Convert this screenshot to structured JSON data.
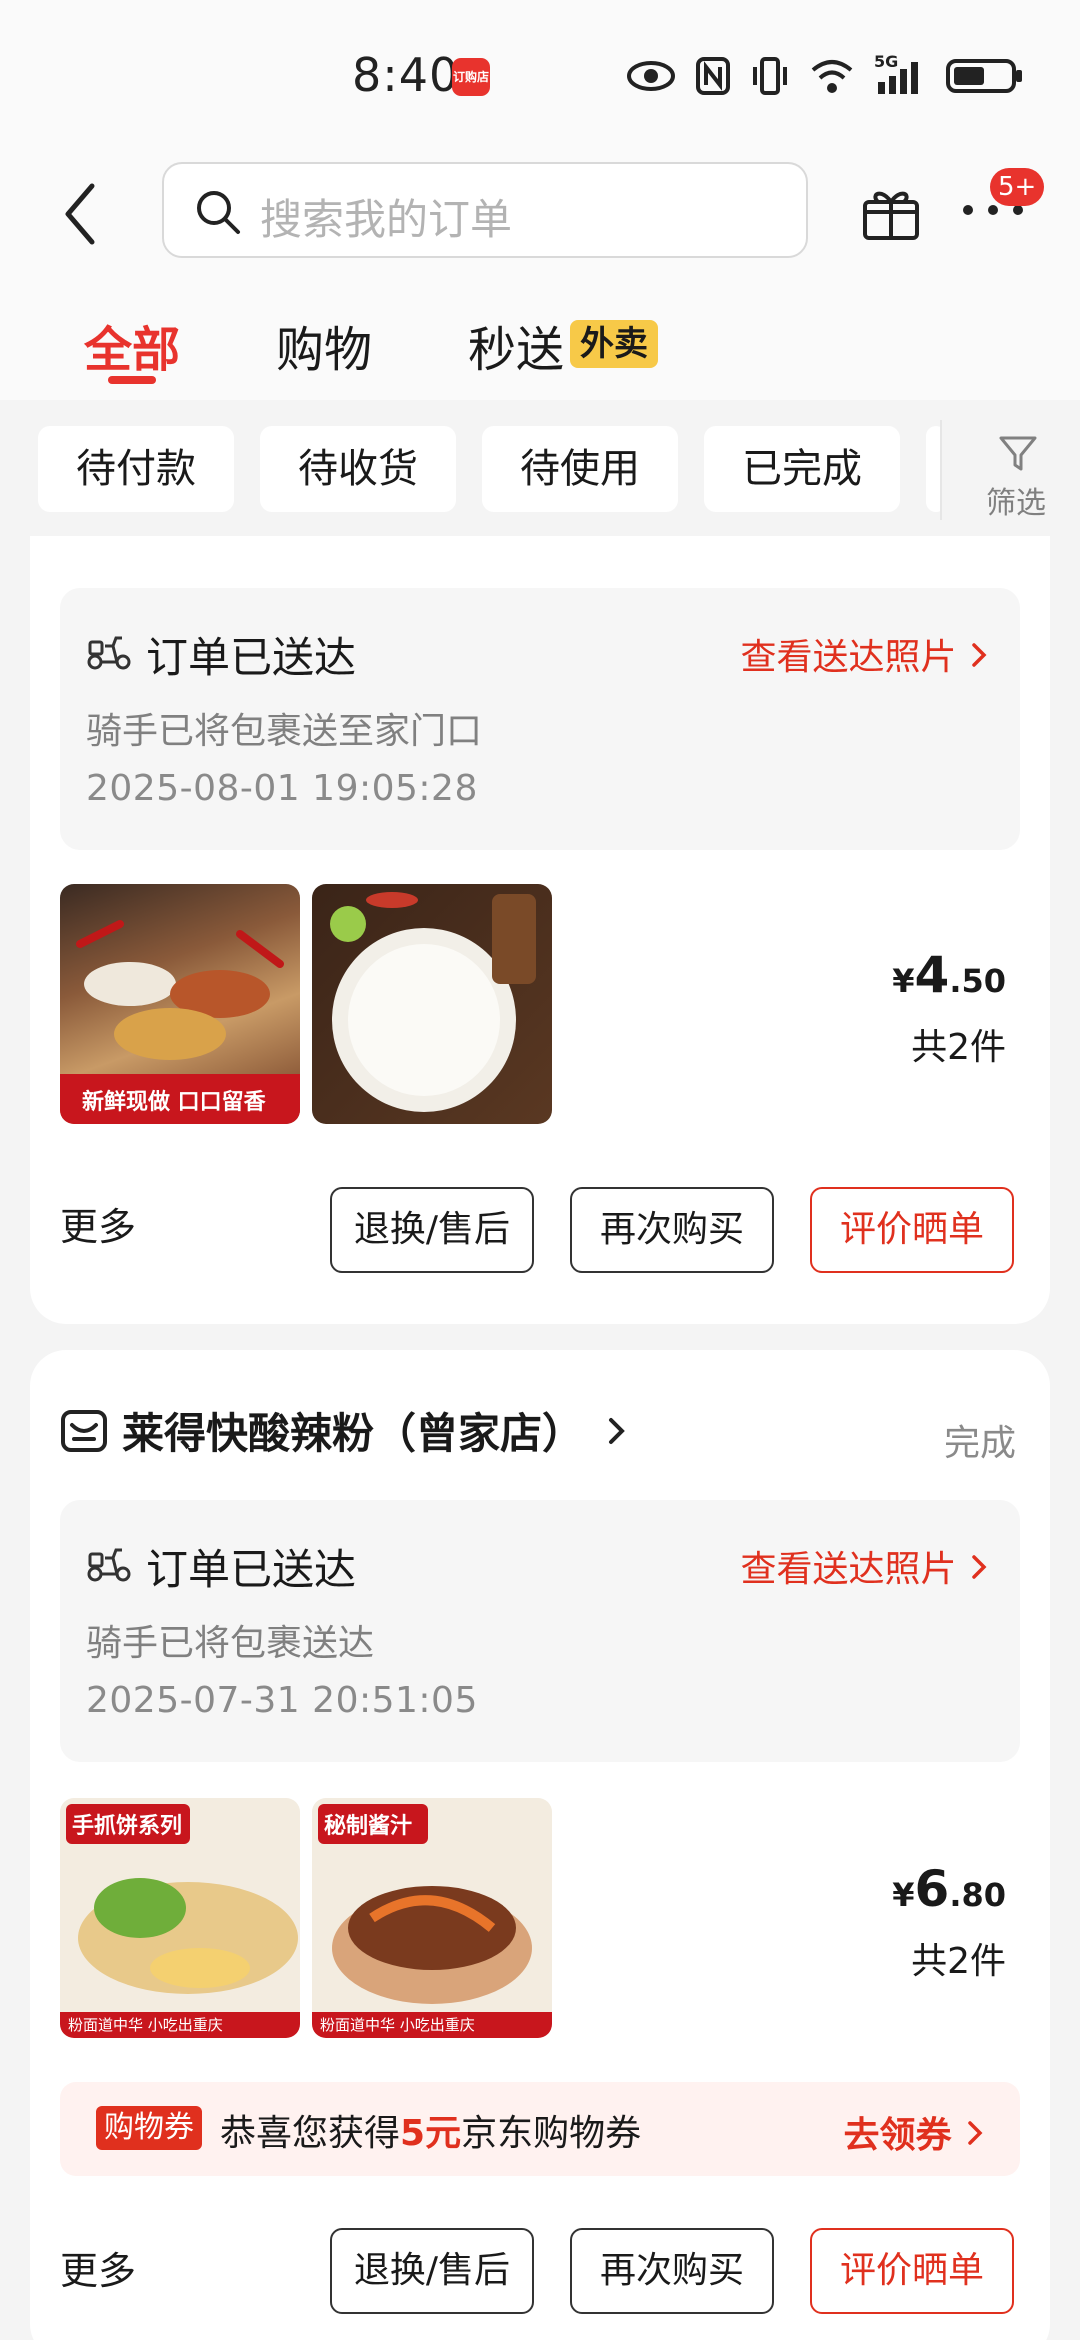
{
  "status_bar": {
    "time": "8:40",
    "app_badge": "订购店",
    "network": "5G"
  },
  "header": {
    "search_placeholder": "搜索我的订单",
    "more_badge": "5+"
  },
  "tabs": [
    {
      "label": "全部"
    },
    {
      "label": "购物"
    },
    {
      "label": "秒送"
    }
  ],
  "tab_tag": "外卖",
  "filters": [
    {
      "label": "待付款"
    },
    {
      "label": "待收货"
    },
    {
      "label": "待使用"
    },
    {
      "label": "已完成"
    }
  ],
  "filter_button": "筛选",
  "orders": [
    {
      "delivery_title": "订单已送达",
      "photo_link": "查看送达照片",
      "delivery_desc": "骑手已将包裹送至家门口",
      "delivery_time": "2025-08-01 19:05:28",
      "thumb1_caption": "新鲜现做 口口留香",
      "price_yen": "¥",
      "price_int": "4",
      "price_dec": ".50",
      "count": "共2件",
      "more": "更多",
      "btn_return": "退换/售后",
      "btn_rebuy": "再次购买",
      "btn_review": "评价晒单"
    },
    {
      "shop_name": "莱得快酸辣粉（曾家店）",
      "status": "完成",
      "delivery_title": "订单已送达",
      "photo_link": "查看送达照片",
      "delivery_desc": "骑手已将包裹送达",
      "delivery_time": "2025-07-31 20:51:05",
      "thumb1_tag": "手抓饼系列",
      "thumb2_tag": "秘制酱汁",
      "thumb_footer": "粉面道中华 小吃出重庆",
      "price_yen": "¥",
      "price_int": "6",
      "price_dec": ".80",
      "count": "共2件",
      "coupon_tag": "购物券",
      "coupon_pre": "恭喜您获得",
      "coupon_amount": "5元",
      "coupon_post": "京东购物券",
      "coupon_go": "去领券",
      "more": "更多",
      "btn_return": "退换/售后",
      "btn_rebuy": "再次购买",
      "btn_review": "评价晒单"
    }
  ],
  "colors": {
    "accent_red": "#e0301e",
    "tag_yellow": "#f7c948",
    "bg": "#f4f4f4"
  }
}
